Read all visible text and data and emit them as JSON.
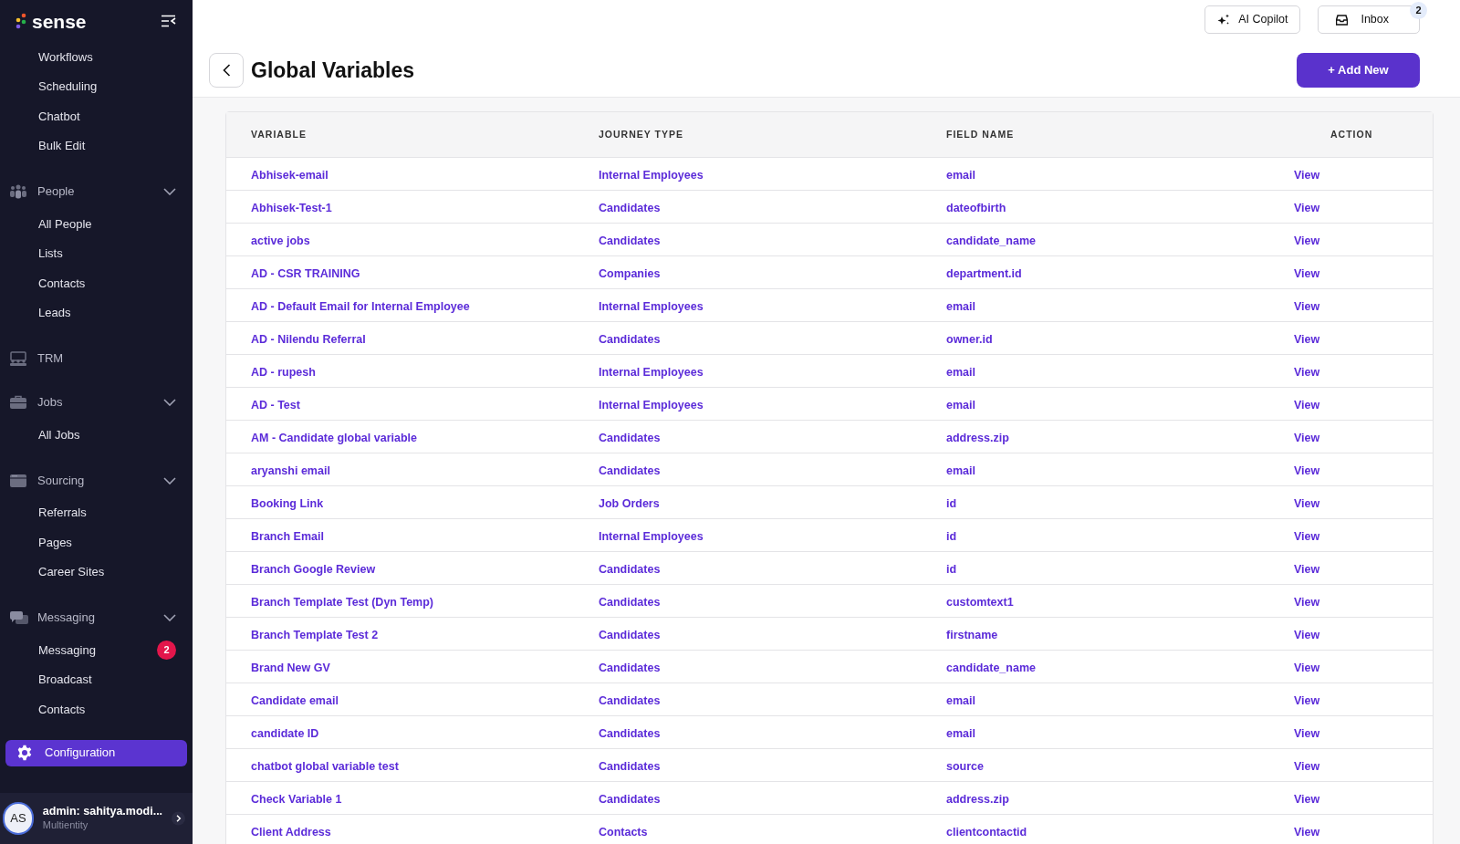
{
  "brand": {
    "name": "sense"
  },
  "sidebar": {
    "top_links": [
      "Workflows",
      "Scheduling",
      "Chatbot",
      "Bulk Edit"
    ],
    "sections": [
      {
        "kind": "group",
        "label": "People",
        "expanded": true,
        "selected": false,
        "children": [
          {
            "label": "All People"
          },
          {
            "label": "Lists"
          },
          {
            "label": "Contacts"
          },
          {
            "label": "Leads"
          }
        ]
      },
      {
        "kind": "link",
        "label": "TRM",
        "selected": false
      },
      {
        "kind": "group",
        "label": "Jobs",
        "expanded": true,
        "selected": false,
        "children": [
          {
            "label": "All Jobs"
          }
        ]
      },
      {
        "kind": "group",
        "label": "Sourcing",
        "expanded": true,
        "selected": false,
        "children": [
          {
            "label": "Referrals"
          },
          {
            "label": "Pages"
          },
          {
            "label": "Career Sites"
          }
        ]
      },
      {
        "kind": "group",
        "label": "Messaging",
        "expanded": true,
        "selected": false,
        "children": [
          {
            "label": "Messaging",
            "badge": "2"
          },
          {
            "label": "Broadcast"
          },
          {
            "label": "Contacts"
          }
        ]
      },
      {
        "kind": "link",
        "label": "Configuration",
        "selected": true
      }
    ],
    "user": {
      "initials": "AS",
      "name": "admin: sahitya.modi...",
      "role": "Multientity"
    }
  },
  "topbar": {
    "copilot": "AI Copilot",
    "inbox": "Inbox",
    "inbox_badge": "2"
  },
  "page": {
    "title": "Global Variables",
    "add_button": "+ Add New"
  },
  "table": {
    "columns": [
      "VARIABLE",
      "JOURNEY TYPE",
      "FIELD NAME",
      "ACTION"
    ],
    "rows": [
      [
        "Abhisek-email",
        "Internal Employees",
        "email",
        "View"
      ],
      [
        "Abhisek-Test-1",
        "Candidates",
        "dateofbirth",
        "View"
      ],
      [
        "active jobs",
        "Candidates",
        "candidate_name",
        "View"
      ],
      [
        "AD - CSR TRAINING",
        "Companies",
        "department.id",
        "View"
      ],
      [
        "AD - Default Email for Internal Employee",
        "Internal Employees",
        "email",
        "View"
      ],
      [
        "AD - Nilendu Referral",
        "Candidates",
        "owner.id",
        "View"
      ],
      [
        "AD - rupesh",
        "Internal Employees",
        "email",
        "View"
      ],
      [
        "AD - Test",
        "Internal Employees",
        "email",
        "View"
      ],
      [
        "AM - Candidate global variable",
        "Candidates",
        "address.zip",
        "View"
      ],
      [
        "aryanshi email",
        "Candidates",
        "email",
        "View"
      ],
      [
        "Booking Link",
        "Job Orders",
        "id",
        "View"
      ],
      [
        "Branch Email",
        "Internal Employees",
        "id",
        "View"
      ],
      [
        "Branch Google Review",
        "Candidates",
        "id",
        "View"
      ],
      [
        "Branch Template Test (Dyn Temp)",
        "Candidates",
        "customtext1",
        "View"
      ],
      [
        "Branch Template Test 2",
        "Candidates",
        "firstname",
        "View"
      ],
      [
        "Brand New GV",
        "Candidates",
        "candidate_name",
        "View"
      ],
      [
        "Candidate email",
        "Candidates",
        "email",
        "View"
      ],
      [
        "candidate ID",
        "Candidates",
        "email",
        "View"
      ],
      [
        "chatbot global variable test",
        "Candidates",
        "source",
        "View"
      ],
      [
        "Check Variable 1",
        "Candidates",
        "address.zip",
        "View"
      ],
      [
        "Client Address",
        "Contacts",
        "clientcontactid",
        "View"
      ]
    ]
  }
}
